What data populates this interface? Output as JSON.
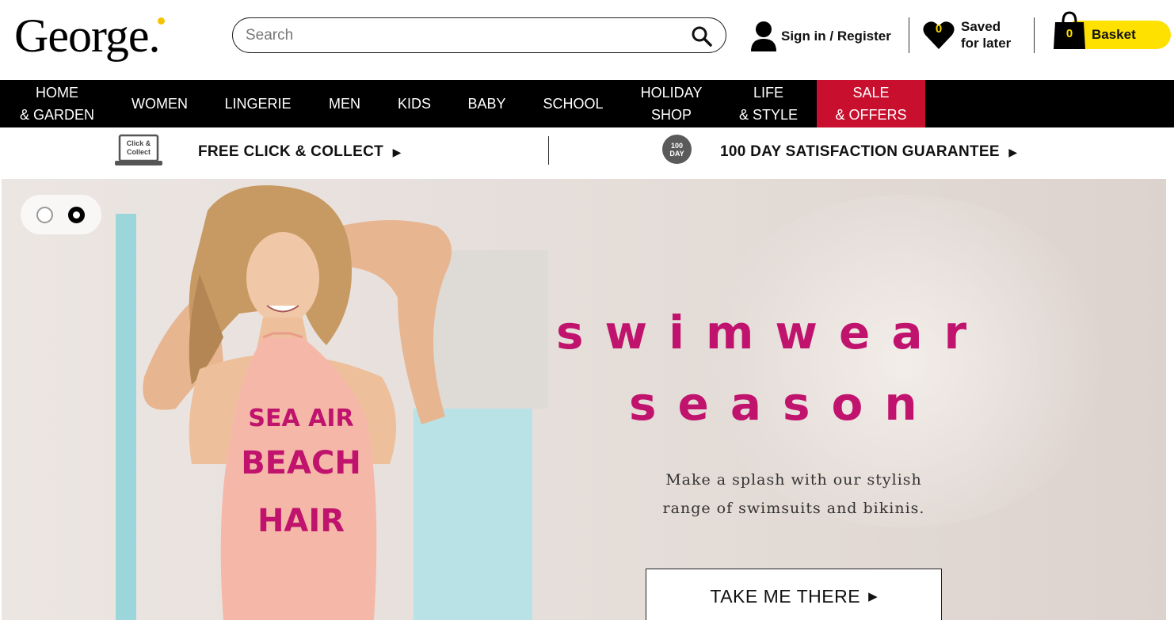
{
  "brand": {
    "logo_text": "George"
  },
  "search": {
    "placeholder": "Search"
  },
  "account": {
    "signin_label": "Sign in / Register"
  },
  "saved": {
    "count": "0",
    "label_line1": "Saved",
    "label_line2": "for later"
  },
  "basket": {
    "count": "0",
    "label": "Basket"
  },
  "nav": {
    "items": [
      {
        "line1": "HOME",
        "line2": "& GARDEN"
      },
      {
        "line1": "WOMEN",
        "line2": ""
      },
      {
        "line1": "LINGERIE",
        "line2": ""
      },
      {
        "line1": "MEN",
        "line2": ""
      },
      {
        "line1": "KIDS",
        "line2": ""
      },
      {
        "line1": "BABY",
        "line2": ""
      },
      {
        "line1": "SCHOOL",
        "line2": ""
      },
      {
        "line1": "HOLIDAY",
        "line2": "SHOP"
      },
      {
        "line1": "LIFE",
        "line2": "& STYLE"
      },
      {
        "line1": "SALE",
        "line2": "& OFFERS"
      }
    ]
  },
  "info": {
    "click_collect_icon_line1": "Click &",
    "click_collect_icon_line2": "Collect",
    "click_collect": "FREE CLICK & COLLECT",
    "guarantee_badge_line1": "100",
    "guarantee_badge_line2": "DAY",
    "guarantee": "100 DAY SATISFACTION GUARANTEE"
  },
  "hero": {
    "headline_line1": "swimwear",
    "headline_line2": "season",
    "swimsuit_print_line1": "SEA AIR",
    "swimsuit_print_line2": "BEACH",
    "swimsuit_print_line3": "HAIR",
    "copy_line1": "Make a splash with our stylish",
    "copy_line2": "range of swimsuits and bikinis.",
    "cta_label": "TAKE ME THERE",
    "carousel_active_index": 2,
    "carousel_total": 2
  },
  "colors": {
    "brand_yellow": "#ffe100",
    "sale_red": "#c8102e",
    "headline_magenta": "#c0136d",
    "nav_black": "#000000"
  }
}
